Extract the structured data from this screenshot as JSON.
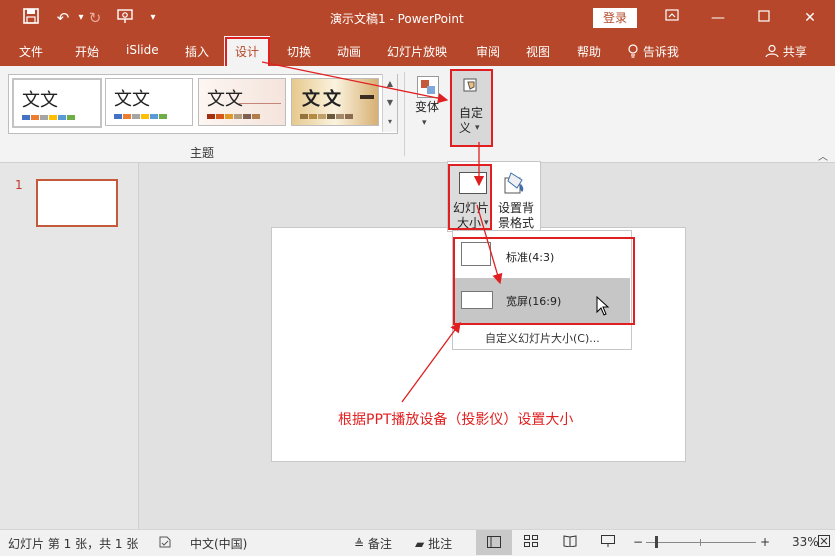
{
  "titlebar": {
    "title": "演示文稿1  -  PowerPoint",
    "login_label": "登录"
  },
  "tabs": [
    "文件",
    "开始",
    "iSlide",
    "插入",
    "设计",
    "切换",
    "动画",
    "幻灯片放映",
    "审阅",
    "视图",
    "帮助"
  ],
  "tell_me": "告诉我",
  "share_label": "共享",
  "ribbon": {
    "theme_sample_text": "文文",
    "theme_group_label": "主题",
    "variants_label": "变体",
    "customize_label_1": "自定",
    "customize_label_2": "义"
  },
  "customize_menu": {
    "slide_size_label_1": "幻灯片",
    "slide_size_label_2": "大小",
    "format_bg_label_1": "设置背",
    "format_bg_label_2": "景格式"
  },
  "size_menu": {
    "standard": "标准(4:3)",
    "widescreen": "宽屏(16:9)",
    "custom": "自定义幻灯片大小(C)..."
  },
  "thumbnail": {
    "number": "1"
  },
  "annotation": "根据PPT播放设备（投影仪）设置大小",
  "status": {
    "slide_info": "幻灯片 第 1 张，共 1 张",
    "language": "中文(中国)",
    "notes_label": "备注",
    "comments_label": "批注",
    "zoom": "33%"
  },
  "colors": {
    "accent": "#b7472a",
    "highlight": "#e02020",
    "annotation_text": "#e02020"
  }
}
